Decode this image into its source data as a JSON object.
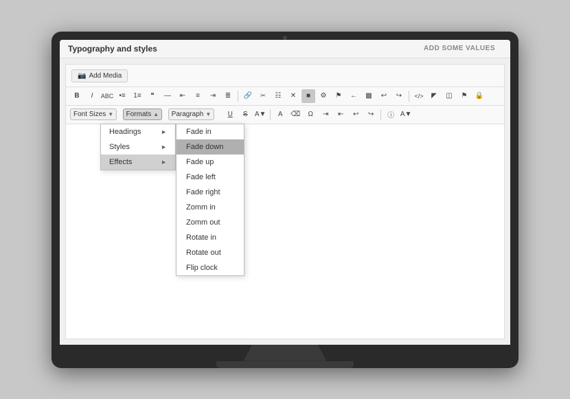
{
  "monitor": {
    "title": "Typography and styles",
    "add_values_link": "ADD SOME VALUES"
  },
  "toolbar": {
    "add_media_label": "Add Media",
    "row1_buttons": [
      "B",
      "I",
      "ABC",
      "≡",
      "≡",
      "❝",
      "—",
      "≡",
      "≡",
      "≡",
      "✂",
      "⊞",
      "✕",
      "▦",
      "⚙",
      "⚑",
      "⟵",
      "▣",
      "↩",
      "↪",
      "⊡",
      "◻",
      "◫",
      "◪",
      "★",
      "🔒"
    ],
    "font_sizes_label": "Font Sizes",
    "formats_label": "Formats",
    "paragraph_label": "Paragraph"
  },
  "formats_menu": {
    "items": [
      {
        "label": "Headings",
        "has_submenu": true
      },
      {
        "label": "Styles",
        "has_submenu": true
      },
      {
        "label": "Effects",
        "has_submenu": true,
        "active": true
      }
    ]
  },
  "effects_submenu": {
    "items": [
      {
        "label": "Fade in",
        "highlighted": false
      },
      {
        "label": "Fade down",
        "highlighted": true
      },
      {
        "label": "Fade up",
        "highlighted": false
      },
      {
        "label": "Fade left",
        "highlighted": false
      },
      {
        "label": "Fade right",
        "highlighted": false
      },
      {
        "label": "Zomm in",
        "highlighted": false
      },
      {
        "label": "Zomm out",
        "highlighted": false
      },
      {
        "label": "Rotate in",
        "highlighted": false
      },
      {
        "label": "Rotate out",
        "highlighted": false
      },
      {
        "label": "Flip clock",
        "highlighted": false
      }
    ]
  }
}
